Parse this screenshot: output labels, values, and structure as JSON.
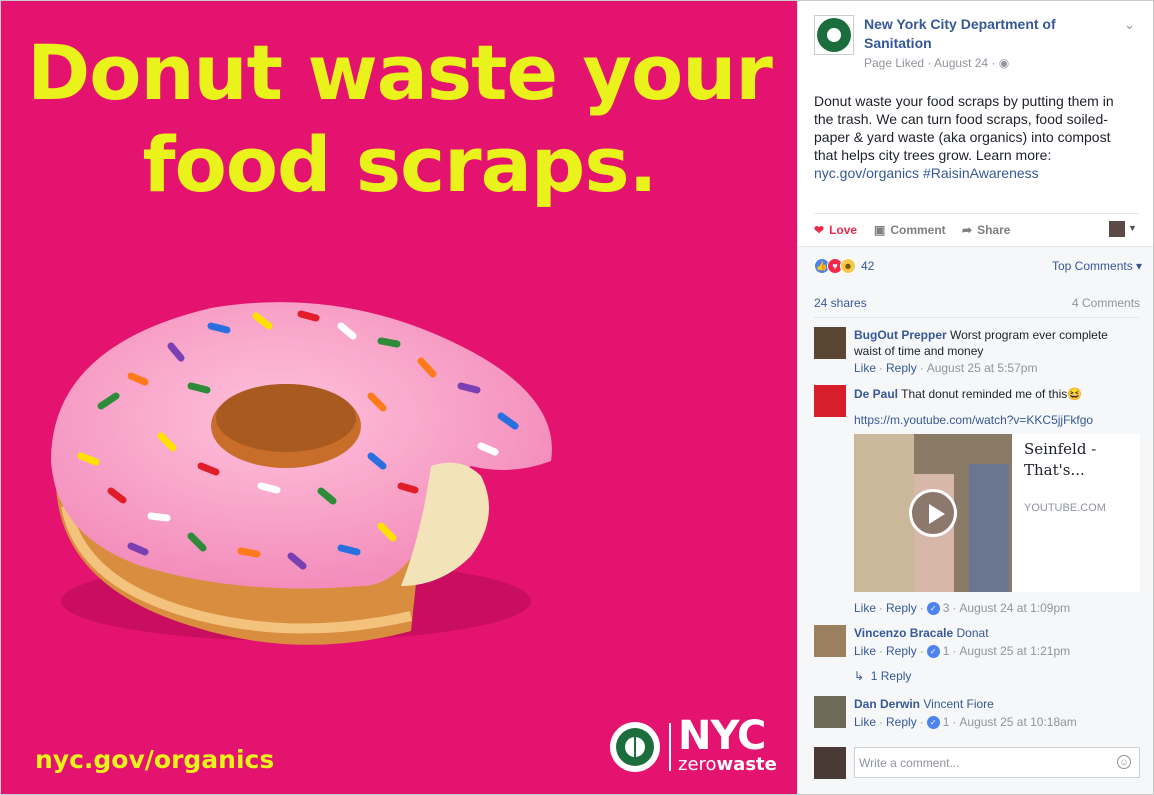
{
  "image_panel": {
    "headline_line1": "Donut waste your",
    "headline_line2": "food scraps.",
    "url": "nyc.gov/organics",
    "logo_nyc": "NYC",
    "logo_zero": "zero",
    "logo_waste": "waste",
    "background_color": "#e4136f",
    "text_color": "#e9f21a"
  },
  "post": {
    "page_name": "New York City Department of Sanitation",
    "page_meta": "Page Liked · August 24 ·",
    "text_main": "Donut waste your food scraps by putting them in the trash. We can turn food scraps, food soiled-paper & yard waste (aka organics) into compost that helps city trees grow. Learn more:",
    "text_link": "nyc.gov/organics #RaisinAwareness",
    "actions": {
      "love": "Love",
      "comment": "Comment",
      "share": "Share"
    },
    "reaction_count": "42",
    "top_comments": "Top Comments",
    "shares": "24 shares",
    "comments_count": "4 Comments"
  },
  "comments": [
    {
      "name": "BugOut Prepper",
      "text": "Worst program ever complete waist of time and money",
      "like": "Like",
      "reply": "Reply",
      "time": "August 25 at 5:57pm"
    },
    {
      "name": "De Paul",
      "text": "That donut reminded me of this",
      "link": "https://m.youtube.com/watch?v=KKC5jjFkfgo",
      "video_title": "Seinfeld - That's...",
      "video_domain": "YOUTUBE.COM",
      "like": "Like",
      "reply": "Reply",
      "likes": "3",
      "time": "August 24 at 1:09pm"
    },
    {
      "name": "Vincenzo Bracale",
      "text": "Donat",
      "like": "Like",
      "reply": "Reply",
      "likes": "1",
      "time": "August 25 at 1:21pm",
      "replies": "1 Reply"
    },
    {
      "name": "Dan Derwin",
      "text": "Vincent Fiore",
      "like": "Like",
      "reply": "Reply",
      "likes": "1",
      "time": "August 25 at 10:18am"
    }
  ],
  "composer": {
    "placeholder": "Write a comment..."
  }
}
